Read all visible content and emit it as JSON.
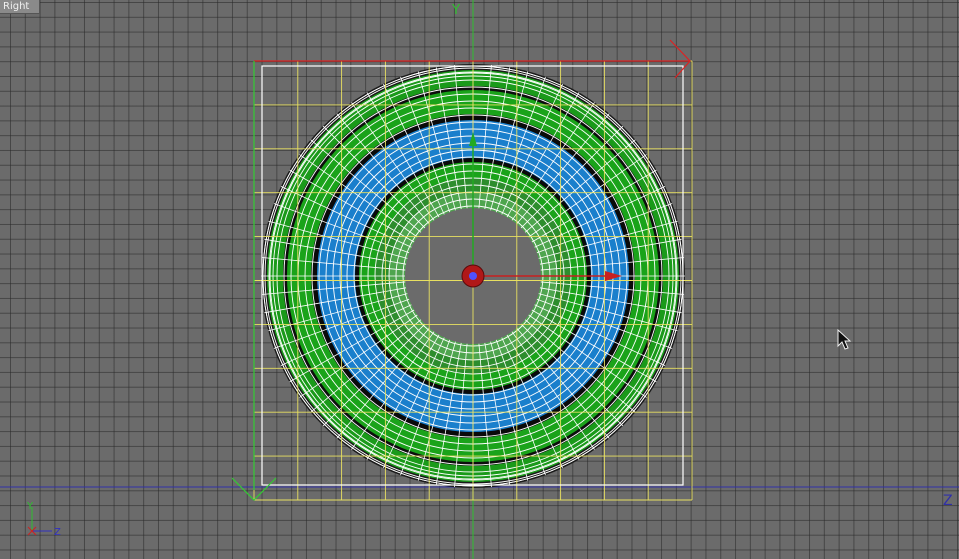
{
  "viewport": {
    "label": "Right"
  },
  "axes": {
    "world_vertical": "Y",
    "world_horizontal": "Z",
    "gizmo_vertical": "Y",
    "gizmo_horizontal": "Z"
  },
  "colors": {
    "background": "#6b6b6b",
    "grid_line": "#3a3a3a",
    "y_axis": "#33cc33",
    "z_axis": "#3333aa",
    "selection_x": "#dd2222",
    "mesh_wire": "#ffffff",
    "bbox_grid": "#e8e060",
    "ring_green": "#1aa31a",
    "ring_blue": "#1a7fcc",
    "pivot": "#c81414"
  },
  "icons": {
    "cursor": "mouse-pointer-icon",
    "pivot": "object-pivot-icon",
    "move_gizmo": "move-gizmo-icon",
    "axis_gizmo": "axis-tripod-icon"
  }
}
